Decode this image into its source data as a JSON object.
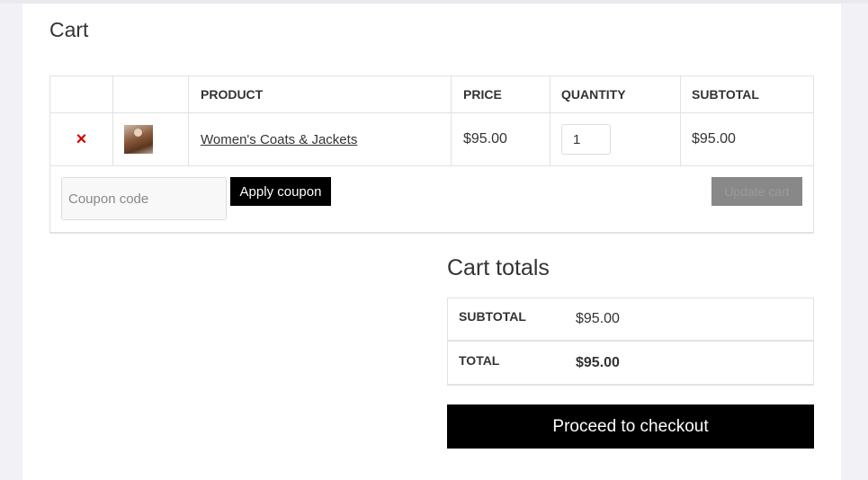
{
  "page": {
    "title": "Cart"
  },
  "cart_table": {
    "headers": [
      "",
      "",
      "PRODUCT",
      "PRICE",
      "QUANTITY",
      "SUBTOTAL"
    ],
    "items": [
      {
        "remove_icon": "×",
        "thumbnail": "product-image-icon",
        "name": "Women's Coats & Jackets",
        "price": "$95.00",
        "quantity": "1",
        "subtotal": "$95.00"
      }
    ]
  },
  "coupon": {
    "placeholder": "Coupon code",
    "value": "",
    "apply_label": "Apply coupon"
  },
  "update_cart_label": "Update cart",
  "totals": {
    "title": "Cart totals",
    "subtotal_label": "SUBTOTAL",
    "subtotal_value": "$95.00",
    "total_label": "TOTAL",
    "total_value": "$95.00"
  },
  "checkout_label": "Proceed to checkout",
  "colors": {
    "remove": "#d40000",
    "button_bg": "#000000",
    "disabled_button": "#888888"
  }
}
